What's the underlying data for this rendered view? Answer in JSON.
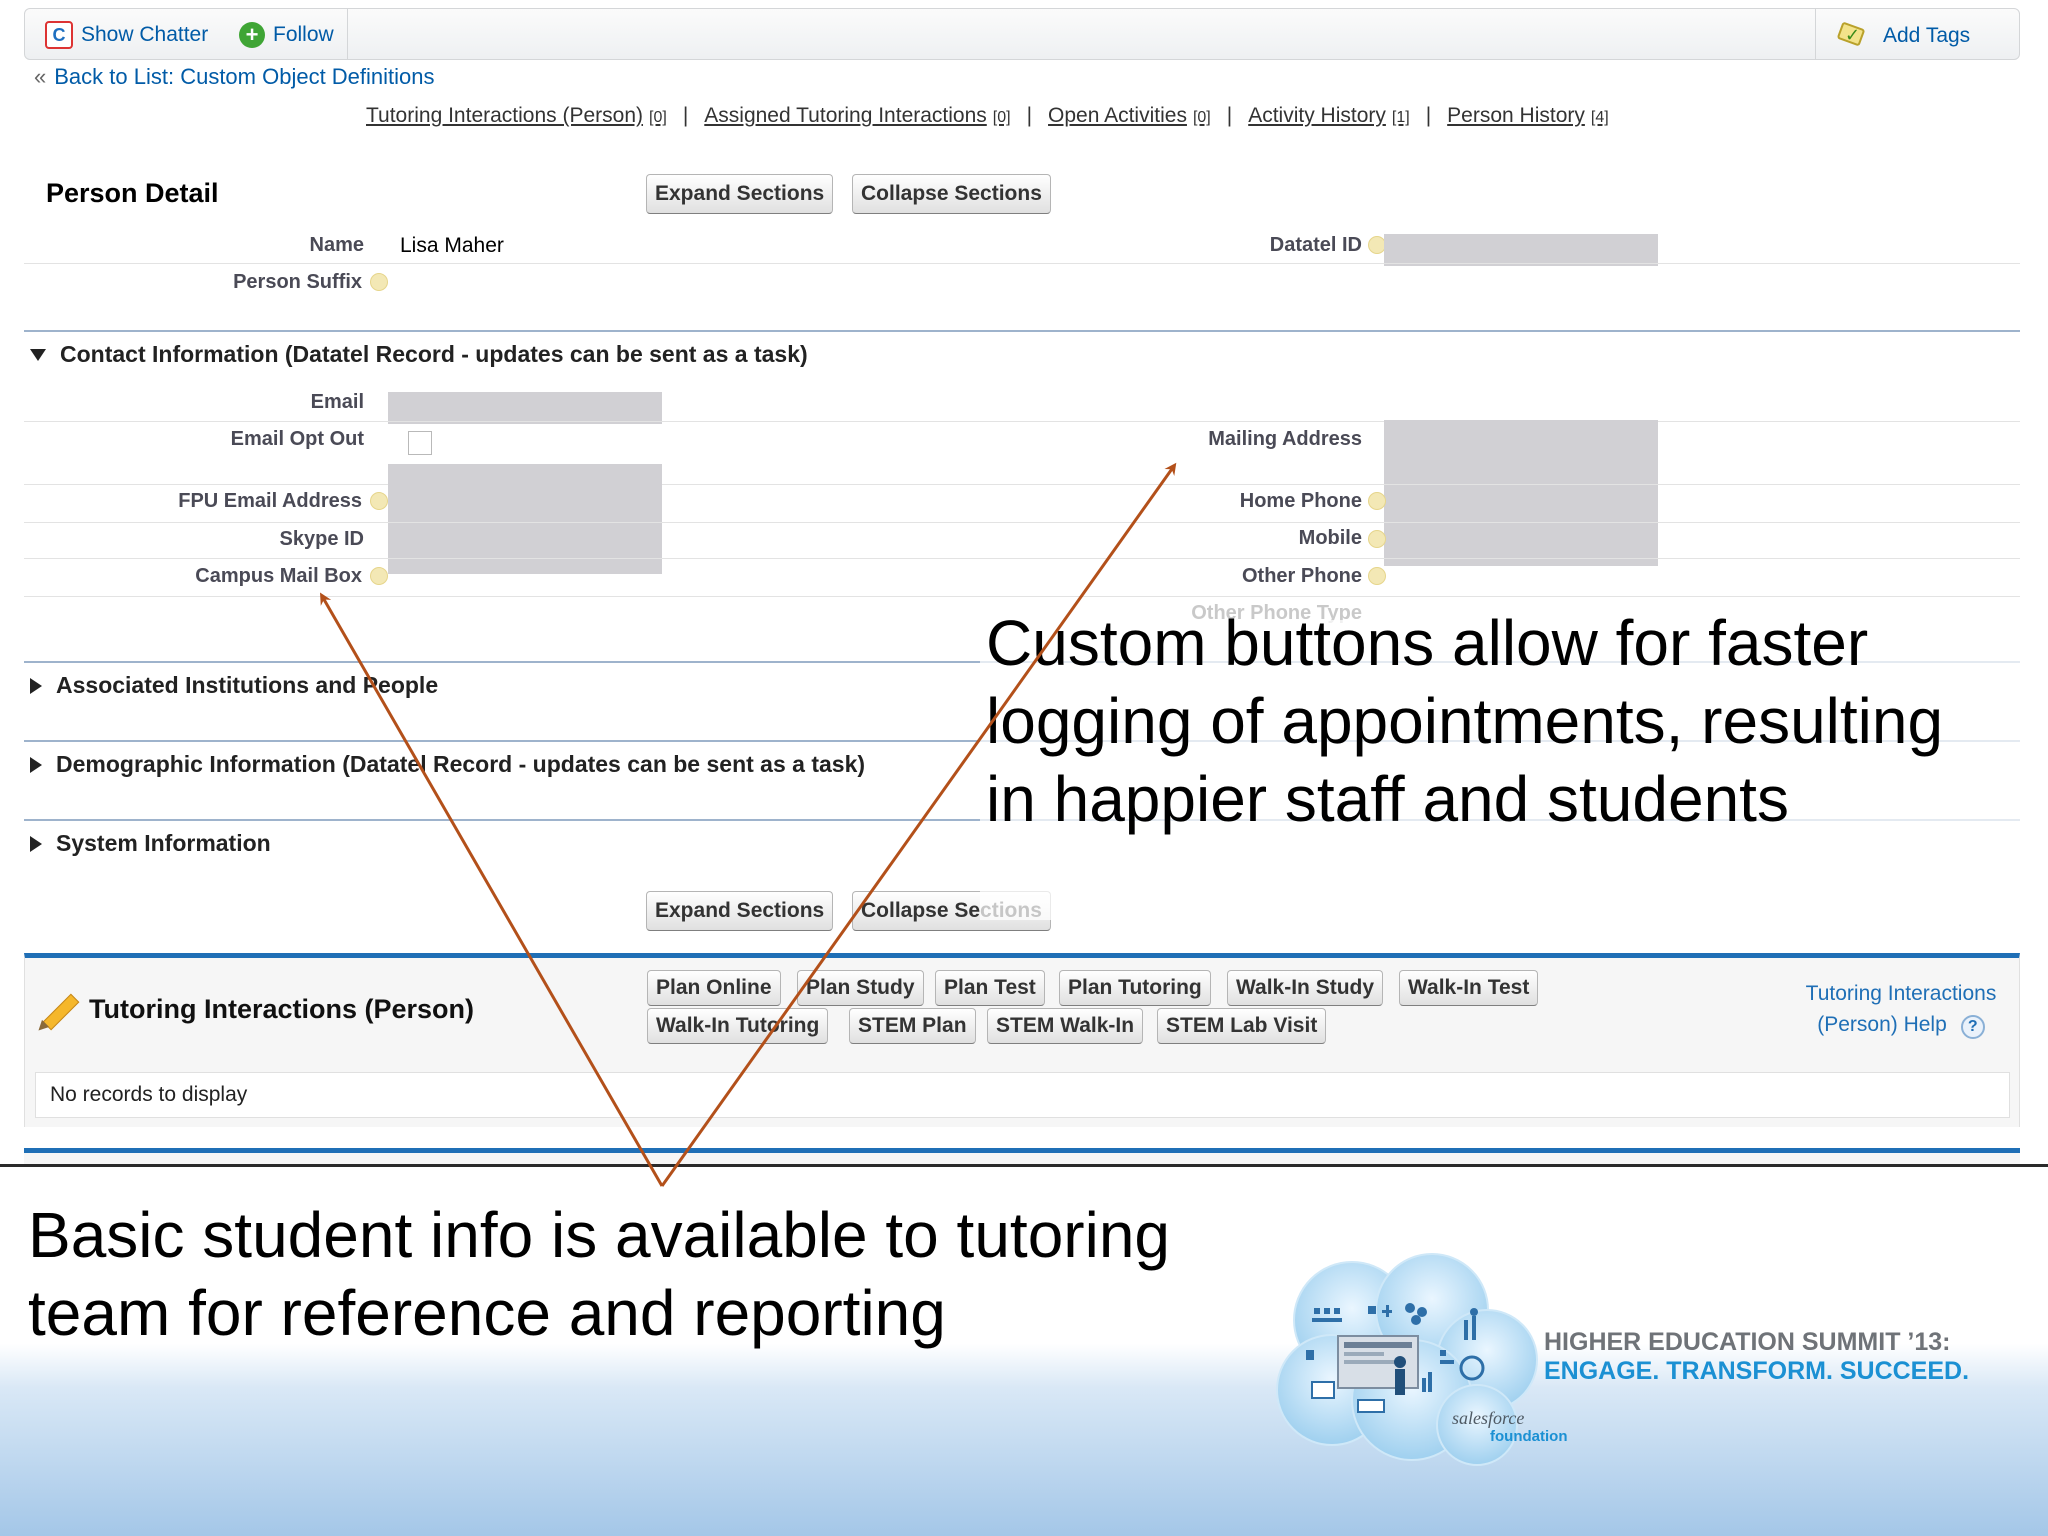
{
  "chatter_bar": {
    "show_chatter": "Show Chatter",
    "follow": "Follow",
    "add_tags": "Add Tags"
  },
  "back_link": {
    "prefix": "«",
    "label": "Back to List: Custom Object Definitions"
  },
  "related_links": [
    {
      "label": "Tutoring Interactions (Person)",
      "count": "[0]"
    },
    {
      "label": "Assigned Tutoring Interactions",
      "count": "[0]"
    },
    {
      "label": "Open Activities",
      "count": "[0]"
    },
    {
      "label": "Activity History",
      "count": "[1]"
    },
    {
      "label": "Person History",
      "count": "[4]"
    }
  ],
  "related_separator": "|",
  "detail": {
    "title": "Person Detail",
    "expand_label": "Expand Sections",
    "collapse_label": "Collapse Sections",
    "name_label": "Name",
    "name_value": "Lisa Maher",
    "datatel_label": "Datatel ID",
    "suffix_label": "Person Suffix"
  },
  "contact_section": {
    "title": "Contact Information (Datatel Record - updates can be sent as a task)",
    "fields_left": [
      "Email",
      "Email Opt Out",
      "FPU Email Address",
      "Skype ID",
      "Campus Mail Box"
    ],
    "fields_right": [
      "Mailing Address",
      "Home Phone",
      "Mobile",
      "Other Phone",
      "Other Phone Type"
    ]
  },
  "collapsed_sections": [
    "Associated Institutions and People",
    "Demographic Information (Datatel Record - updates can be sent as a task)",
    "System Information"
  ],
  "bottom_buttons": {
    "expand_label": "Expand Sections",
    "collapse_label": "Collapse Sections"
  },
  "tutoring": {
    "title": "Tutoring Interactions (Person)",
    "buttons_row1": [
      "Plan Online",
      "Plan Study",
      "Plan Test",
      "Plan Tutoring",
      "Walk-In Study",
      "Walk-In Test"
    ],
    "buttons_row2": [
      "Walk-In Tutoring",
      "STEM Plan",
      "STEM Walk-In",
      "STEM Lab Visit"
    ],
    "help_line1": "Tutoring Interactions",
    "help_line2": "(Person) Help",
    "help_icon": "?",
    "no_records": "No records to display"
  },
  "annotations": {
    "custom_buttons": "Custom buttons allow for faster logging of appointments, resulting in happier staff and students",
    "basic_info": "Basic student info is available to tutoring team for reference and reporting"
  },
  "branding": {
    "summit_line1": "HIGHER EDUCATION SUMMIT ’13:",
    "summit_line2": "ENGAGE. TRANSFORM. SUCCEED.",
    "salesforce": "salesforce",
    "foundation": "foundation"
  },
  "colors": {
    "link_blue": "#015ba7",
    "section_blue": "#1f6fb6",
    "arrow_brown": "#b3501a",
    "summit_blue": "#1b90d3",
    "summit_gray": "#6f7378"
  }
}
